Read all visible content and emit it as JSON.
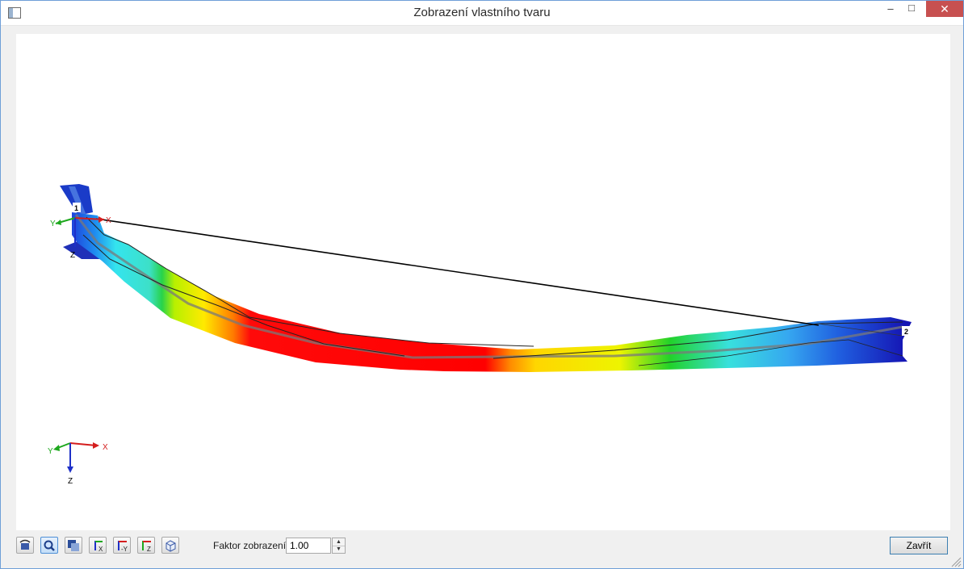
{
  "window": {
    "title": "Zobrazení vlastního tvaru"
  },
  "title_controls": {
    "minimize": "–",
    "maximize": "□",
    "close": "✕"
  },
  "model": {
    "node_labels": [
      "1",
      "2"
    ],
    "local_axes": {
      "x": "X",
      "y": "Y",
      "z": "Z"
    }
  },
  "global_axes": {
    "x": "X",
    "y": "Y",
    "z": "Z"
  },
  "toolbar": {
    "icons": [
      "rotate-view-icon",
      "zoom-icon",
      "render-mode-icon",
      "view-x-icon",
      "view-minus-y-icon",
      "view-z-icon",
      "isometric-view-icon"
    ],
    "view_labels": {
      "x": "X",
      "minus_y": "-Y",
      "z": "Z"
    }
  },
  "factor": {
    "label": "Faktor zobrazení:",
    "value": "1.00"
  },
  "close_button": {
    "label": "Zavřít"
  },
  "colors": {
    "max": "#ff0000",
    "high": "#ffe600",
    "mid": "#00d000",
    "low": "#00e0ff",
    "min": "#0000c8",
    "accent": "#3c7fb1",
    "close_red": "#c75050"
  }
}
